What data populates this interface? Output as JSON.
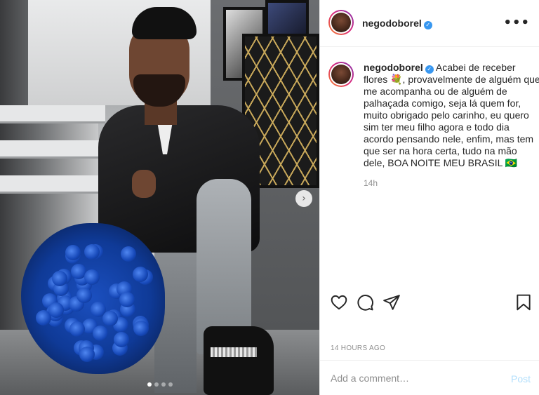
{
  "post": {
    "username": "negodoborel",
    "caption": "Acabei de receber flores 💐, provavelmente de alguém que me acompanha ou de alguém de palhaçada comigo, seja lá quem for, muito obrigado pelo carinho, eu quero sim ter meu filho agora e todo dia acordo pensando nele, enfim, mas tem que ser na hora certa, tudo na mão dele, BOA NOITE MEU BRASIL 🇧🇷",
    "caption_time": "14h",
    "timestamp": "14 HOURS AGO",
    "verified_icon": "verified-check-icon",
    "more_icon": "more-options-icon"
  },
  "carousel": {
    "current_slide": 1,
    "total_slides": 4,
    "next_icon": "chevron-right-icon"
  },
  "actions": {
    "like_icon": "heart-icon",
    "comment_icon": "comment-icon",
    "share_icon": "paper-plane-icon",
    "save_icon": "bookmark-icon"
  },
  "comment": {
    "placeholder": "Add a comment…",
    "post_label": "Post"
  },
  "colors": {
    "verified": "#3897f0",
    "post_disabled": "#b2dffc",
    "secondary_text": "#8e8e8e",
    "border": "#efefef"
  }
}
